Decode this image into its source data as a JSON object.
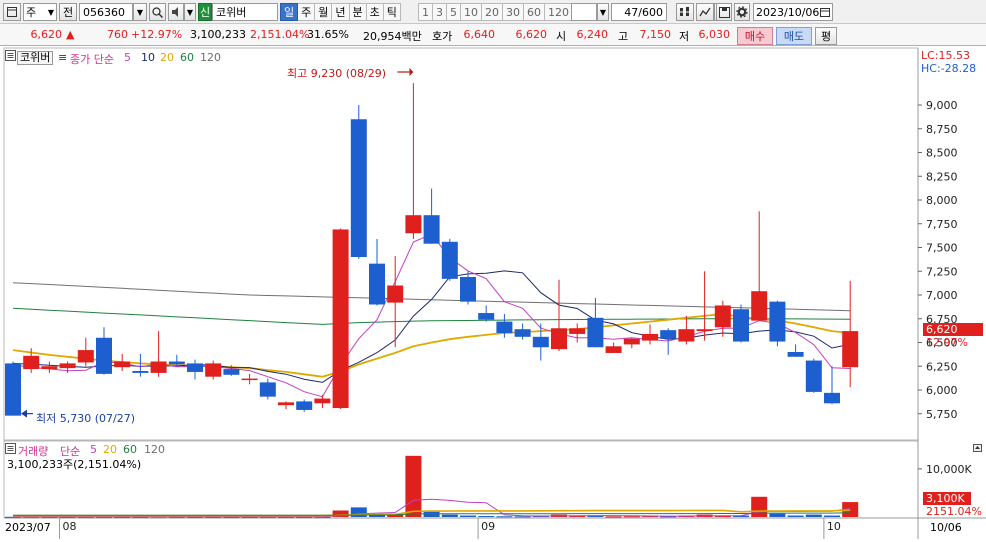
{
  "toolbar": {
    "market_type": "주",
    "prefix_label": "전",
    "stock_code": "056360",
    "new_badge": "신",
    "stock_name": "코위버",
    "periods": [
      "일",
      "주",
      "월",
      "년",
      "분",
      "초",
      "틱"
    ],
    "active_period": "일",
    "intervals": [
      "1",
      "3",
      "5",
      "10",
      "20",
      "30",
      "60",
      "120"
    ],
    "count_display": "47/600",
    "date": "2023/10/06"
  },
  "quote": {
    "price": "6,620",
    "change": "760",
    "change_pct": "+12.97%",
    "volume": "3,100,233",
    "volume_ratio": "2,151.04%",
    "turnover": "31.65%",
    "amount": "20,954백만",
    "ask_label": "호가",
    "ask_value": "6,640",
    "bid_value": "6,620",
    "open_label": "시",
    "open": "6,240",
    "high_label": "고",
    "high": "7,150",
    "low_label": "저",
    "low": "6,030",
    "buy_label": "매수",
    "sell_label": "매도",
    "avg_label": "평"
  },
  "price_panel": {
    "name_tag": "코위버",
    "ma_title": "종가 단순",
    "ma_periods": [
      "5",
      "10",
      "20",
      "60",
      "120"
    ],
    "lc_label": "LC:15.53",
    "hc_label": "HC:-28.28",
    "high_annotation": "최고 9,230 (08/29)",
    "low_annotation": "최저 5,730 (07/27)",
    "current_price_tag": "6,620",
    "current_pct_tag": "12.97%"
  },
  "volume_panel": {
    "title": "거래량",
    "ma_title": "단순",
    "ma_periods": [
      "5",
      "20",
      "60",
      "120"
    ],
    "summary": "3,100,233주(2,151.04%)",
    "current_tag": "3,100K",
    "current_pct_tag": "2151.04%"
  },
  "x_axis": {
    "left_label": "2023/07",
    "right_label": "10/06"
  },
  "colors": {
    "up": "#e0201c",
    "down": "#1e5fd0",
    "ma5": "#c040c0",
    "ma10": "#1a2a6a",
    "ma20": "#e0a800",
    "ma60": "#208040",
    "ma120": "#707070"
  },
  "chart_data": [
    {
      "type": "candlestick",
      "y_axis": {
        "ticks": [
          "9,000",
          "8,750",
          "8,500",
          "8,250",
          "8,000",
          "7,750",
          "7,500",
          "7,250",
          "7,000",
          "6,750",
          "6,500",
          "6,250",
          "6,000",
          "5,750"
        ],
        "ylim": [
          5600,
          9400
        ]
      },
      "month_labels": [
        {
          "label": "08",
          "index": 3
        },
        {
          "label": "09",
          "index": 26
        },
        {
          "label": "10",
          "index": 45
        }
      ],
      "candles": [
        {
          "o": 6280,
          "h": 6300,
          "l": 5730,
          "c": 5730
        },
        {
          "o": 6220,
          "h": 6440,
          "l": 6180,
          "c": 6360
        },
        {
          "o": 6220,
          "h": 6300,
          "l": 6180,
          "c": 6250
        },
        {
          "o": 6230,
          "h": 6300,
          "l": 6180,
          "c": 6280
        },
        {
          "o": 6290,
          "h": 6550,
          "l": 6250,
          "c": 6420
        },
        {
          "o": 6550,
          "h": 6660,
          "l": 6160,
          "c": 6170
        },
        {
          "o": 6240,
          "h": 6380,
          "l": 6200,
          "c": 6300
        },
        {
          "o": 6200,
          "h": 6380,
          "l": 6140,
          "c": 6180
        },
        {
          "o": 6180,
          "h": 6620,
          "l": 6140,
          "c": 6300
        },
        {
          "o": 6300,
          "h": 6370,
          "l": 6250,
          "c": 6270
        },
        {
          "o": 6280,
          "h": 6320,
          "l": 6110,
          "c": 6190
        },
        {
          "o": 6140,
          "h": 6310,
          "l": 6110,
          "c": 6280
        },
        {
          "o": 6220,
          "h": 6260,
          "l": 6150,
          "c": 6160
        },
        {
          "o": 6120,
          "h": 6170,
          "l": 6060,
          "c": 6120
        },
        {
          "o": 6080,
          "h": 6120,
          "l": 5900,
          "c": 5930
        },
        {
          "o": 5840,
          "h": 5880,
          "l": 5800,
          "c": 5870
        },
        {
          "o": 5880,
          "h": 5900,
          "l": 5770,
          "c": 5790
        },
        {
          "o": 5860,
          "h": 5950,
          "l": 5810,
          "c": 5910
        },
        {
          "o": 5810,
          "h": 7700,
          "l": 5800,
          "c": 7690
        },
        {
          "o": 8850,
          "h": 9000,
          "l": 7380,
          "c": 7400
        },
        {
          "o": 7330,
          "h": 7590,
          "l": 6890,
          "c": 6900
        },
        {
          "o": 6920,
          "h": 7410,
          "l": 6450,
          "c": 7100
        },
        {
          "o": 7650,
          "h": 9230,
          "l": 7590,
          "c": 7840
        },
        {
          "o": 7840,
          "h": 8120,
          "l": 7540,
          "c": 7540
        },
        {
          "o": 7560,
          "h": 7590,
          "l": 7150,
          "c": 7170
        },
        {
          "o": 7190,
          "h": 7250,
          "l": 6900,
          "c": 6930
        },
        {
          "o": 6810,
          "h": 6890,
          "l": 6720,
          "c": 6740
        },
        {
          "o": 6720,
          "h": 6800,
          "l": 6550,
          "c": 6600
        },
        {
          "o": 6640,
          "h": 6700,
          "l": 6530,
          "c": 6560
        },
        {
          "o": 6560,
          "h": 6700,
          "l": 6310,
          "c": 6450
        },
        {
          "o": 6430,
          "h": 7160,
          "l": 6410,
          "c": 6650
        },
        {
          "o": 6590,
          "h": 6700,
          "l": 6500,
          "c": 6650
        },
        {
          "o": 6760,
          "h": 6970,
          "l": 6450,
          "c": 6450
        },
        {
          "o": 6390,
          "h": 6500,
          "l": 6390,
          "c": 6460
        },
        {
          "o": 6480,
          "h": 6550,
          "l": 6440,
          "c": 6540
        },
        {
          "o": 6520,
          "h": 6690,
          "l": 6480,
          "c": 6590
        },
        {
          "o": 6630,
          "h": 6650,
          "l": 6370,
          "c": 6540
        },
        {
          "o": 6510,
          "h": 6780,
          "l": 6480,
          "c": 6640
        },
        {
          "o": 6620,
          "h": 7250,
          "l": 6520,
          "c": 6640
        },
        {
          "o": 6660,
          "h": 6940,
          "l": 6560,
          "c": 6890
        },
        {
          "o": 6850,
          "h": 6900,
          "l": 6500,
          "c": 6510
        },
        {
          "o": 6730,
          "h": 7880,
          "l": 6740,
          "c": 7040
        },
        {
          "o": 6930,
          "h": 6940,
          "l": 6460,
          "c": 6510
        },
        {
          "o": 6400,
          "h": 6480,
          "l": 6350,
          "c": 6350
        },
        {
          "o": 6310,
          "h": 6330,
          "l": 5970,
          "c": 5980
        },
        {
          "o": 5970,
          "h": 6250,
          "l": 5850,
          "c": 5860
        },
        {
          "o": 6240,
          "h": 7150,
          "l": 6030,
          "c": 6620
        }
      ],
      "ma_series": [
        {
          "period": 5,
          "values": [
            6264,
            6238,
            6222,
            6203,
            6208,
            6296,
            6284,
            6244,
            6274,
            6244,
            6248,
            6244,
            6226,
            6204,
            6140,
            6076,
            5982,
            5928,
            6262,
            6540,
            6740,
            7140,
            7558,
            7640,
            7392,
            7254,
            7172,
            6930,
            6860,
            6652,
            6592,
            6548,
            6552,
            6534,
            6550,
            6532,
            6516,
            6562,
            6618,
            6650,
            6652,
            6730,
            6700,
            6604,
            6478,
            6234,
            6226
          ]
        },
        {
          "period": 10,
          "values": [
            6280,
            6272,
            6260,
            6248,
            6240,
            6252,
            6262,
            6248,
            6256,
            6252,
            6270,
            6260,
            6236,
            6236,
            6196,
            6166,
            6114,
            6080,
            6206,
            6292,
            6394,
            6526,
            6778,
            6954,
            7192,
            7222,
            7230,
            7254,
            7234,
            7024,
            6894,
            6858,
            6736,
            6696,
            6604,
            6564,
            6534,
            6546,
            6578,
            6600,
            6592,
            6620,
            6632,
            6612,
            6566,
            6442,
            6482
          ]
        },
        {
          "period": 20,
          "values": [
            6420,
            6395,
            6370,
            6350,
            6330,
            6310,
            6295,
            6280,
            6270,
            6260,
            6255,
            6250,
            6240,
            6230,
            6210,
            6190,
            6165,
            6140,
            6195,
            6270,
            6330,
            6390,
            6460,
            6500,
            6535,
            6560,
            6580,
            6600,
            6610,
            6620,
            6630,
            6640,
            6660,
            6680,
            6700,
            6720,
            6740,
            6760,
            6780,
            6800,
            6770,
            6750,
            6730,
            6700,
            6660,
            6620,
            6600
          ]
        },
        {
          "period": 60,
          "values": [
            6860,
            6850,
            6840,
            6830,
            6820,
            6810,
            6800,
            6790,
            6780,
            6770,
            6760,
            6750,
            6740,
            6730,
            6720,
            6710,
            6700,
            6690,
            6700,
            6710,
            6715,
            6720,
            6725,
            6728,
            6730,
            6732,
            6734,
            6736,
            6738,
            6740,
            6741,
            6742,
            6743,
            6744,
            6745,
            6746,
            6747,
            6748,
            6749,
            6750,
            6750,
            6750,
            6749,
            6748,
            6747,
            6746,
            6745
          ]
        },
        {
          "period": 120,
          "values": [
            7130,
            7120,
            7110,
            7100,
            7090,
            7080,
            7070,
            7060,
            7050,
            7040,
            7030,
            7020,
            7010,
            7000,
            6995,
            6990,
            6985,
            6980,
            6975,
            6970,
            6965,
            6960,
            6955,
            6950,
            6945,
            6940,
            6935,
            6930,
            6925,
            6920,
            6915,
            6910,
            6905,
            6900,
            6895,
            6890,
            6885,
            6880,
            6875,
            6870,
            6865,
            6860,
            6855,
            6850,
            6845,
            6840,
            6835
          ]
        }
      ]
    },
    {
      "type": "bar",
      "y_axis": {
        "ticks": [
          "10,000K"
        ],
        "ylim": [
          0,
          13500
        ]
      },
      "volumes": [
        50,
        60,
        40,
        30,
        40,
        45,
        30,
        35,
        100,
        40,
        30,
        35,
        30,
        25,
        40,
        30,
        25,
        45,
        1350,
        2000,
        600,
        700,
        12700,
        1100,
        500,
        300,
        200,
        150,
        140,
        200,
        500,
        300,
        300,
        120,
        150,
        200,
        150,
        300,
        500,
        200,
        300,
        4200,
        700,
        300,
        500,
        300,
        3100
      ],
      "ma_series": [
        {
          "period": 5,
          "values": [
            45,
            45,
            45,
            45,
            44,
            43,
            38,
            36,
            48,
            50,
            47,
            42,
            45,
            34,
            32,
            32,
            32,
            33,
            296,
            690,
            800,
            940,
            3470,
            3670,
            3450,
            3060,
            2980,
            450,
            260,
            198,
            238,
            258,
            288,
            284,
            274,
            214,
            184,
            184,
            264,
            270,
            290,
            1100,
            1180,
            1140,
            1200,
            1200,
            1760
          ]
        },
        {
          "period": 20,
          "values": [
            300,
            300,
            300,
            300,
            300,
            300,
            300,
            300,
            300,
            300,
            300,
            300,
            300,
            300,
            300,
            300,
            300,
            300,
            380,
            480,
            510,
            545,
            1180,
            1230,
            1250,
            1260,
            1265,
            1270,
            1272,
            1278,
            1300,
            1310,
            1320,
            1320,
            1320,
            1325,
            1330,
            1340,
            1370,
            1380,
            1090,
            1250,
            1250,
            1260,
            1270,
            1280,
            1420
          ]
        },
        {
          "period": 60,
          "values": [
            360,
            360,
            360,
            360,
            360,
            360,
            360,
            360,
            360,
            360,
            360,
            360,
            360,
            360,
            360,
            360,
            360,
            360,
            380,
            410,
            420,
            430,
            640,
            660,
            670,
            680,
            685,
            688,
            690,
            692,
            695,
            698,
            700,
            702,
            704,
            706,
            708,
            710,
            715,
            718,
            720,
            790,
            800,
            805,
            810,
            815,
            865
          ]
        }
      ]
    }
  ]
}
